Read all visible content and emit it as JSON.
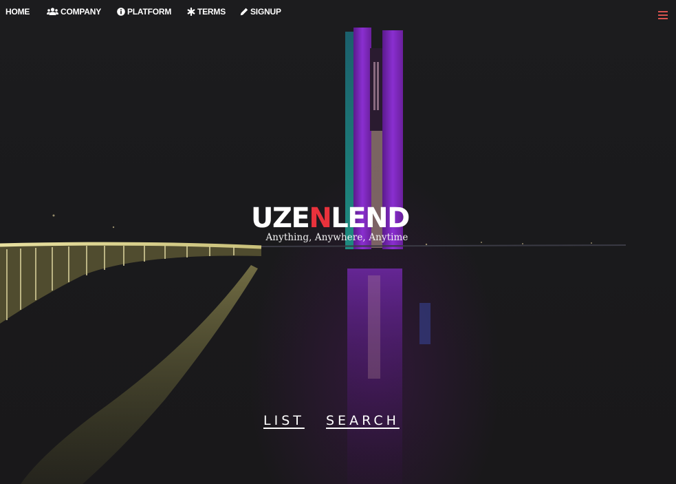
{
  "nav": {
    "items": [
      {
        "label": "HOME",
        "icon": ""
      },
      {
        "label": "COMPANY",
        "icon": "users-icon"
      },
      {
        "label": "PLATFORM",
        "icon": "info-circle-icon"
      },
      {
        "label": "TERMS",
        "icon": "asterisk-icon"
      },
      {
        "label": "SIGNUP",
        "icon": "pencil-icon"
      }
    ],
    "menu_icon": "hamburger-icon",
    "menu_icon_color": "#d9534f"
  },
  "hero": {
    "brand_parts": [
      "UZE",
      "N",
      "LEND"
    ],
    "brand_accent_color": "#e8323c",
    "tagline": "Anything, Anywhere, Anytime"
  },
  "actions": {
    "list_label": "LIST",
    "search_label": "SEARCH"
  }
}
